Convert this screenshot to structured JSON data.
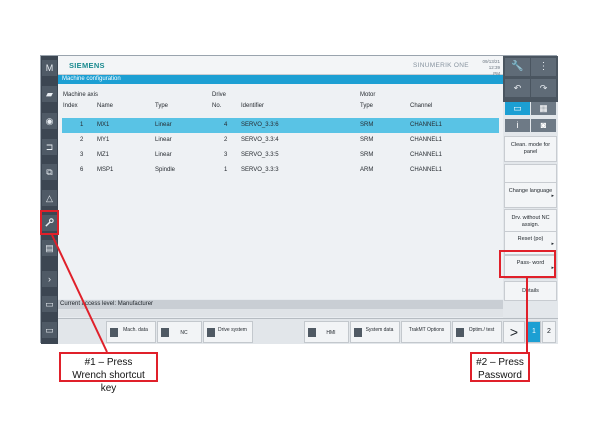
{
  "header": {
    "brand": "SIEMENS",
    "product": "SINUMERIK ONE",
    "date": "09/13/21",
    "time": "12:39 PM"
  },
  "window_title": "Machine configuration",
  "table": {
    "group_headers": {
      "machine_axis": "Machine axis",
      "drive": "Drive",
      "motor": "Motor"
    },
    "columns": {
      "index": "Index",
      "name": "Name",
      "type": "Type",
      "no": "No.",
      "identifier": "Identifier",
      "motor_type": "Type",
      "channel": "Channel"
    },
    "rows": [
      {
        "index": "1",
        "name": "MX1",
        "type": "Linear",
        "no": "4",
        "identifier": "SERVO_3.3:6",
        "motor_type": "SRM",
        "channel": "CHANNEL1"
      },
      {
        "index": "2",
        "name": "MY1",
        "type": "Linear",
        "no": "2",
        "identifier": "SERVO_3.3:4",
        "motor_type": "SRM",
        "channel": "CHANNEL1"
      },
      {
        "index": "3",
        "name": "MZ1",
        "type": "Linear",
        "no": "3",
        "identifier": "SERVO_3.3:5",
        "motor_type": "SRM",
        "channel": "CHANNEL1"
      },
      {
        "index": "6",
        "name": "MSP1",
        "type": "Spindle",
        "no": "1",
        "identifier": "SERVO_3.3:3",
        "motor_type": "ARM",
        "channel": "CHANNEL1"
      }
    ]
  },
  "status": "Current access level: Manufacturer",
  "softkeys_h": {
    "mach_data": "Mach. data",
    "nc": "NC",
    "drive_system": "Drive system",
    "hmi": "HMI",
    "system_data": "System data",
    "trakmt": "TrakMT Options",
    "optim_test": "Optim./ test",
    "next": ">",
    "page1": "1",
    "page2": "2"
  },
  "softkeys_v": {
    "clean_mode": "Clean. mode for panel",
    "change_language": "Change language",
    "drv_without": "Drv. without NC assign.",
    "reset_po": "Reset (po)",
    "password": "Pass- word",
    "details": "Details"
  },
  "annotations": {
    "callout1": "#1 – Press Wrench shortcut key",
    "callout2": "#2 – Press Password"
  },
  "colors": {
    "titlebar": "#1c9fd3",
    "selected_row": "#59c3e5",
    "annotation": "#e0202a"
  },
  "icons": [
    "wrench-icon",
    "undo-icon",
    "redo-icon",
    "info-icon",
    "camera-icon",
    "machine-icon"
  ]
}
